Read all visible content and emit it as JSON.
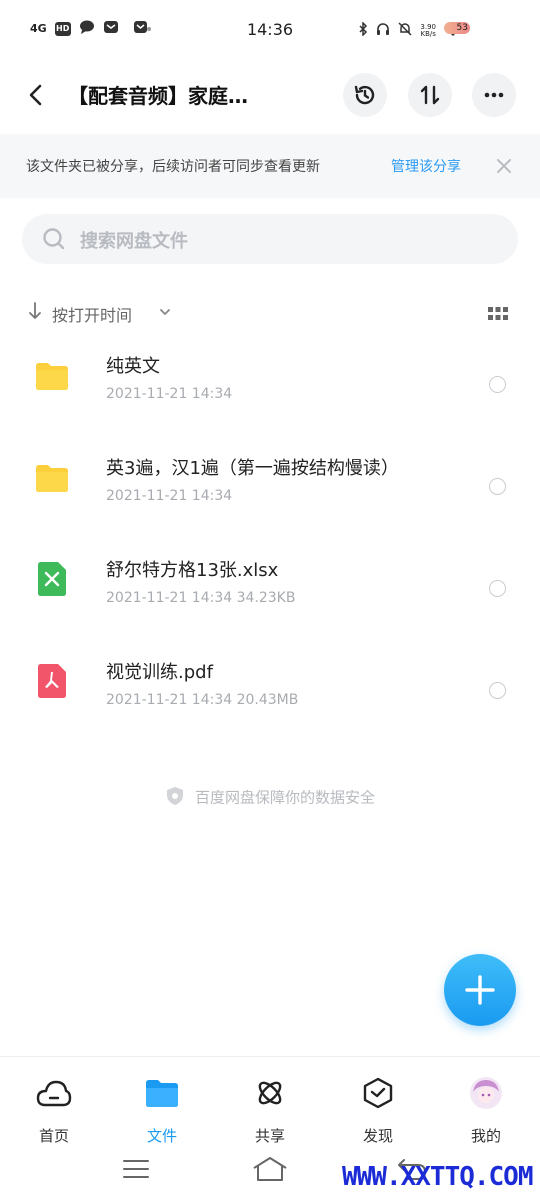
{
  "status": {
    "network": "4G",
    "hd": "HD",
    "time": "14:36",
    "speed_value": "3.90",
    "speed_unit": "KB/s",
    "battery": "53"
  },
  "header": {
    "title": "【配套音频】家庭…"
  },
  "banner": {
    "text": "该文件夹已被分享，后续访问者可同步查看更新",
    "link": "管理该分享",
    "close": "✕"
  },
  "search": {
    "placeholder": "搜索网盘文件"
  },
  "sort": {
    "label": "按打开时间"
  },
  "files": [
    {
      "name": "纯英文",
      "meta": "2021-11-21  14:34",
      "type": "folder"
    },
    {
      "name": "英3遍，汉1遍（第一遍按结构慢读）",
      "meta": "2021-11-21  14:34",
      "type": "folder"
    },
    {
      "name": "舒尔特方格13张.xlsx",
      "meta": "2021-11-21  14:34  34.23KB",
      "type": "xlsx"
    },
    {
      "name": "视觉训练.pdf",
      "meta": "2021-11-21  14:34  20.43MB",
      "type": "pdf"
    }
  ],
  "safety_note": "百度网盘保障你的数据安全",
  "tabs": [
    {
      "label": "首页"
    },
    {
      "label": "文件"
    },
    {
      "label": "共享"
    },
    {
      "label": "发现"
    },
    {
      "label": "我的"
    }
  ],
  "watermark": "WWW.XXTTQ.COM",
  "colors": {
    "accent": "#1a9af1",
    "folder": "#fcd03c",
    "xlsx": "#3fba5b",
    "pdf": "#f2556a"
  }
}
